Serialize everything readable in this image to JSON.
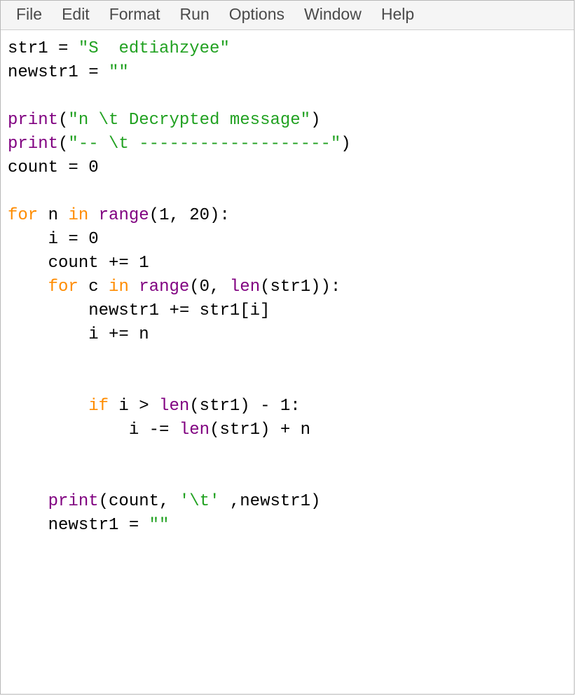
{
  "menu": {
    "file": "File",
    "edit": "Edit",
    "format": "Format",
    "run": "Run",
    "options": "Options",
    "window": "Window",
    "help": "Help"
  },
  "code": {
    "l1_id1": "str1 ",
    "l1_eq": "= ",
    "l1_str": "\"S  edtiahzyee\"",
    "l2_id": "newstr1 ",
    "l2_eq": "= ",
    "l2_str": "\"\"",
    "l4_print": "print",
    "l4_open": "(",
    "l4_str": "\"n \\t Decrypted message\"",
    "l4_close": ")",
    "l5_print": "print",
    "l5_open": "(",
    "l5_str": "\"-- \\t -------------------\"",
    "l5_close": ")",
    "l6": "count = 0",
    "l8_for": "for",
    "l8_sp1": " n ",
    "l8_in": "in",
    "l8_sp2": " ",
    "l8_range": "range",
    "l8_args": "(1, 20):",
    "l9": "    i = 0",
    "l10": "    count += 1",
    "l11_indent": "    ",
    "l11_for": "for",
    "l11_sp1": " c ",
    "l11_in": "in",
    "l11_sp2": " ",
    "l11_range": "range",
    "l11_open": "(0, ",
    "l11_len": "len",
    "l11_rest": "(str1)):",
    "l12": "        newstr1 += str1[i]",
    "l13": "        i += n",
    "l16_indent": "        ",
    "l16_if": "if",
    "l16_mid": " i > ",
    "l16_len": "len",
    "l16_rest": "(str1) - 1:",
    "l17_indent": "            i -= ",
    "l17_len": "len",
    "l17_rest": "(str1) + n",
    "l20_indent": "    ",
    "l20_print": "print",
    "l20_open": "(count, ",
    "l20_str": "'\\t'",
    "l20_rest": " ,newstr1)",
    "l21_indent": "    newstr1 = ",
    "l21_str": "\"\""
  }
}
